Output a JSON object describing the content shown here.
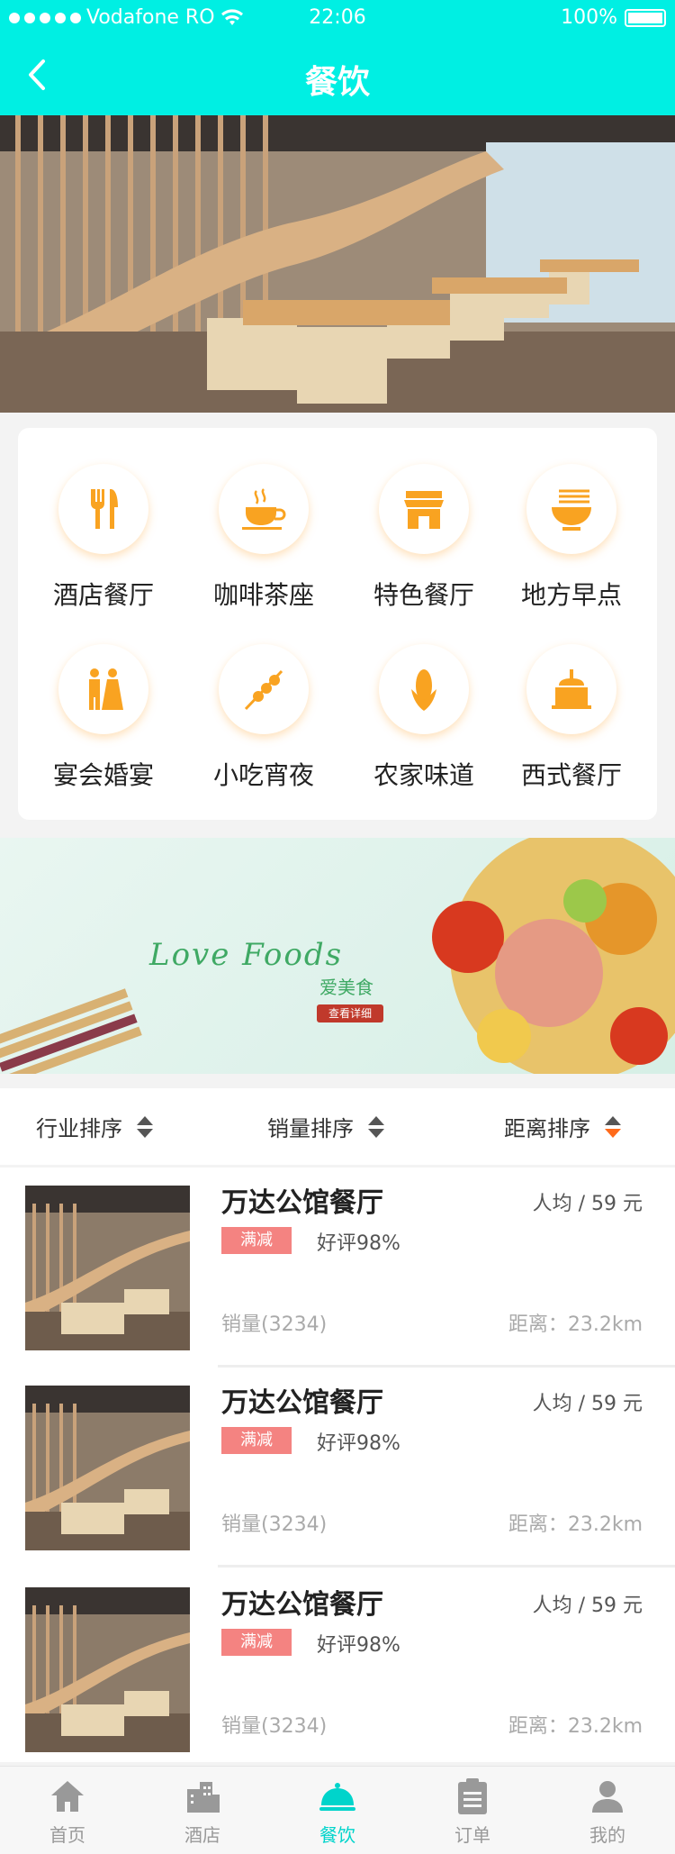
{
  "status": {
    "carrier": "Vodafone RO",
    "time": "22:06",
    "battery": "100%"
  },
  "nav": {
    "title": "餐饮"
  },
  "categories": [
    {
      "label": "酒店餐厅",
      "icon": "fork-knife-icon"
    },
    {
      "label": "咖啡茶座",
      "icon": "coffee-cup-icon"
    },
    {
      "label": "特色餐厅",
      "icon": "shop-icon"
    },
    {
      "label": "地方早点",
      "icon": "noodle-bowl-icon"
    },
    {
      "label": "宴会婚宴",
      "icon": "couple-icon"
    },
    {
      "label": "小吃宵夜",
      "icon": "skewer-icon"
    },
    {
      "label": "农家味道",
      "icon": "corn-icon"
    },
    {
      "label": "西式餐厅",
      "icon": "cake-icon"
    }
  ],
  "banner": {
    "title": "Love Foods",
    "subtitle": "爱美食",
    "button": "查看详细"
  },
  "sort": {
    "industry": "行业排序",
    "sales": "销量排序",
    "distance": "距离排序"
  },
  "restaurants": [
    {
      "name": "万达公馆餐厅",
      "price": "人均 / 59 元",
      "badge": "满减",
      "rating": "好评98%",
      "sales": "销量(3234)",
      "distance": "距离：23.2km"
    },
    {
      "name": "万达公馆餐厅",
      "price": "人均 / 59 元",
      "badge": "满减",
      "rating": "好评98%",
      "sales": "销量(3234)",
      "distance": "距离：23.2km"
    },
    {
      "name": "万达公馆餐厅",
      "price": "人均 / 59 元",
      "badge": "满减",
      "rating": "好评98%",
      "sales": "销量(3234)",
      "distance": "距离：23.2km"
    }
  ],
  "tabs": [
    {
      "label": "首页",
      "icon": "home-icon"
    },
    {
      "label": "酒店",
      "icon": "buildings-icon"
    },
    {
      "label": "餐饮",
      "icon": "cloche-icon"
    },
    {
      "label": "订单",
      "icon": "clipboard-icon"
    },
    {
      "label": "我的",
      "icon": "user-icon"
    }
  ],
  "colors": {
    "accent": "#00EFE3",
    "icon_orange": "#F9A321",
    "badge": "#F48381",
    "active_sort": "#FF6A1A"
  }
}
